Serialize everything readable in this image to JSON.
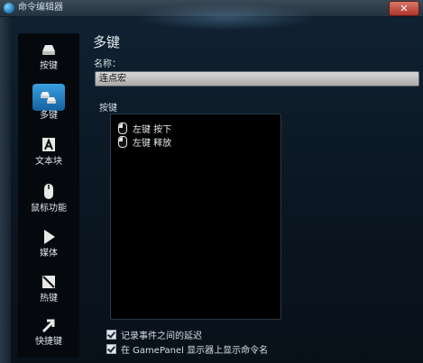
{
  "window": {
    "title": "命令编辑器",
    "close_glyph": "✕"
  },
  "sidebar": {
    "items": [
      {
        "label": "按键",
        "icon": "key-icon"
      },
      {
        "label": "多键",
        "icon": "multikey-icon",
        "active": true
      },
      {
        "label": "文本块",
        "icon": "text-block-icon"
      },
      {
        "label": "鼠标功能",
        "icon": "mouse-icon"
      },
      {
        "label": "媒体",
        "icon": "play-icon"
      },
      {
        "label": "热键",
        "icon": "hotkey-icon"
      },
      {
        "label": "快捷键",
        "icon": "shortcut-arrow-icon"
      }
    ]
  },
  "main": {
    "heading": "多键",
    "name_label": "名称：",
    "name_value": "连点宏",
    "keys_label": "按键",
    "events": [
      {
        "text": "左键 按下"
      },
      {
        "text": "左键 释放"
      }
    ],
    "options": [
      {
        "label": "记录事件之间的延迟",
        "checked": true
      },
      {
        "label": "在 GamePanel 显示器上显示命令名",
        "checked": true
      }
    ]
  },
  "colors": {
    "accent": "#2a86c8",
    "background": "#0b1621",
    "list_bg": "#000000"
  }
}
